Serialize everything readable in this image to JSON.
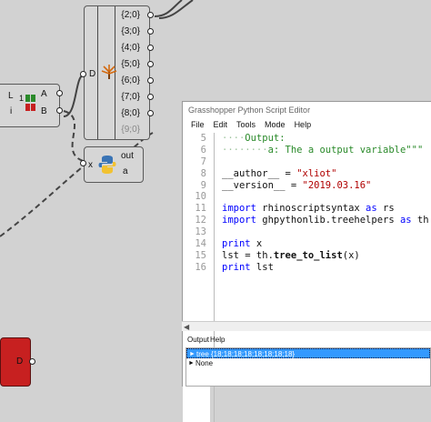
{
  "canvas": {
    "dspace": {
      "input": "D",
      "outputs": [
        "{2;0}",
        "{3;0}",
        "{4;0}",
        "{5;0}",
        "{6;0}",
        "{7;0}",
        "{8;0}",
        "{9;0}"
      ]
    },
    "partial": {
      "input_l": "L",
      "input_i": "i",
      "output_a": "A",
      "output_b": "B",
      "glyph": "12"
    },
    "python_comp": {
      "input": "x",
      "output_out": "out",
      "output_a": "a"
    },
    "red_comp": {
      "input": "D"
    },
    "colors": {
      "background": "#d2d2d2",
      "component": "#d6d6d6",
      "red_component": "#c72020"
    }
  },
  "editor": {
    "title": "Grasshopper Python Script Editor",
    "menu": [
      "File",
      "Edit",
      "Tools",
      "Mode",
      "Help"
    ],
    "lines": [
      {
        "num": "5",
        "parts": [
          {
            "t": "····",
            "c": "dot"
          },
          {
            "t": "Output:",
            "c": "cm"
          }
        ]
      },
      {
        "num": "6",
        "parts": [
          {
            "t": "········",
            "c": "dot"
          },
          {
            "t": "a: The a output variable\"\"\"",
            "c": "cm"
          }
        ]
      },
      {
        "num": "7",
        "parts": []
      },
      {
        "num": "8",
        "parts": [
          {
            "t": "__author__ = ",
            "c": ""
          },
          {
            "t": "\"xliot\"",
            "c": "str"
          }
        ]
      },
      {
        "num": "9",
        "parts": [
          {
            "t": "__version__ = ",
            "c": ""
          },
          {
            "t": "\"2019.03.16\"",
            "c": "str"
          }
        ]
      },
      {
        "num": "10",
        "parts": []
      },
      {
        "num": "11",
        "parts": [
          {
            "t": "import",
            "c": "kw"
          },
          {
            "t": " rhinoscriptsyntax ",
            "c": ""
          },
          {
            "t": "as",
            "c": "kw"
          },
          {
            "t": " rs",
            "c": ""
          }
        ]
      },
      {
        "num": "12",
        "parts": [
          {
            "t": "import",
            "c": "kw"
          },
          {
            "t": " ghpythonlib.treehelpers ",
            "c": ""
          },
          {
            "t": "as",
            "c": "kw"
          },
          {
            "t": " th",
            "c": ""
          }
        ]
      },
      {
        "num": "13",
        "parts": []
      },
      {
        "num": "14",
        "parts": [
          {
            "t": "print",
            "c": "kw"
          },
          {
            "t": " x",
            "c": ""
          }
        ]
      },
      {
        "num": "15",
        "parts": [
          {
            "t": "lst = th.",
            "c": ""
          },
          {
            "t": "tree_to_list",
            "c": "bold"
          },
          {
            "t": "(x)",
            "c": ""
          }
        ]
      },
      {
        "num": "16",
        "parts": [
          {
            "t": "print",
            "c": "kw"
          },
          {
            "t": " lst",
            "c": ""
          }
        ]
      }
    ]
  },
  "output_panel": {
    "tabs": [
      "Output",
      "Help"
    ],
    "rows": [
      {
        "text": "tree {18;18;18;18;18;18;18;18}",
        "selected": true
      },
      {
        "text": "None",
        "selected": false
      }
    ]
  }
}
